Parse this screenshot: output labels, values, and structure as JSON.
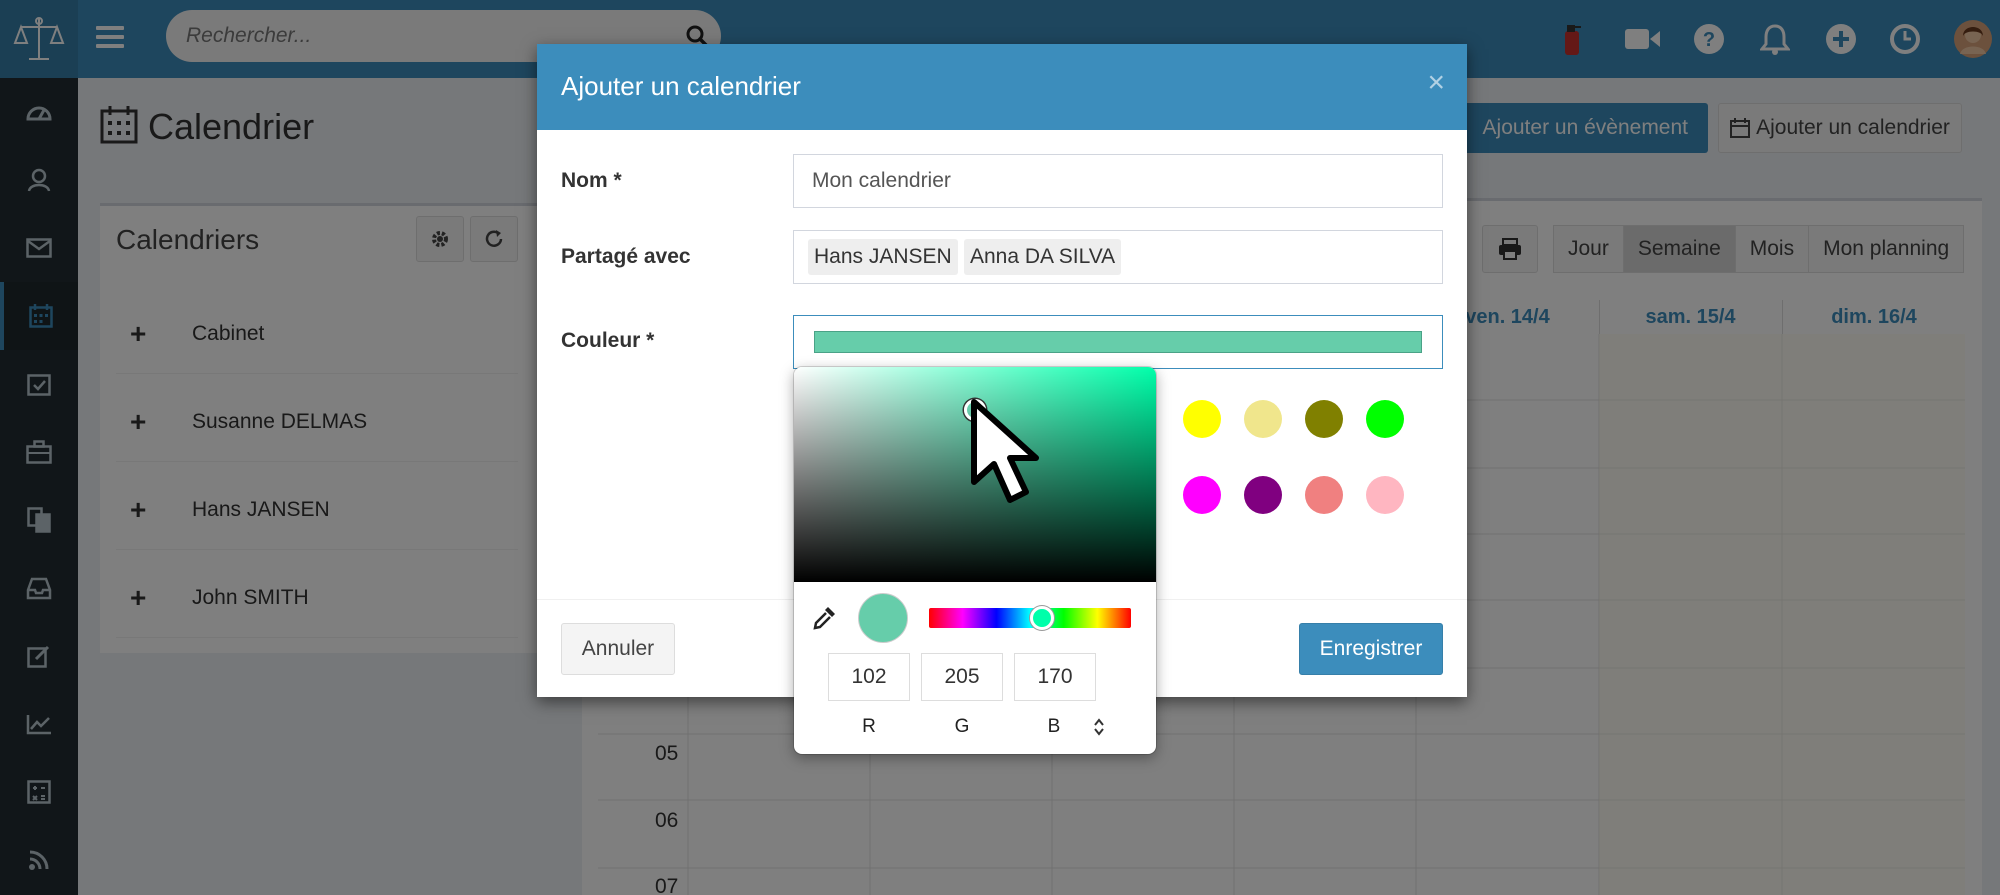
{
  "topbar": {
    "search_placeholder": "Rechercher...",
    "icons": [
      "scales-logo-icon",
      "menu-icon",
      "search-icon",
      "fire-extinguisher-icon",
      "video-icon",
      "help-icon",
      "bell-icon",
      "plus-circle-icon",
      "clock-icon",
      "user-avatar"
    ]
  },
  "sidebar": {
    "icons": [
      "dashboard-icon",
      "contacts-icon",
      "mail-icon",
      "calendar-icon",
      "tasks-icon",
      "briefcase-icon",
      "documents-icon",
      "inbox-icon",
      "edit-icon",
      "chart-icon",
      "calculator-icon",
      "rss-icon"
    ],
    "active": "calendar-icon"
  },
  "page": {
    "title": "Calendrier",
    "add_event_label": "Ajouter un évènement",
    "add_calendar_label": "Ajouter un calendrier"
  },
  "calendars_box": {
    "title": "Calendriers",
    "items": [
      {
        "label": "Cabinet"
      },
      {
        "label": "Susanne DELMAS"
      },
      {
        "label": "Hans JANSEN"
      },
      {
        "label": "John SMITH"
      }
    ]
  },
  "calendar_view": {
    "views": [
      "Jour",
      "Semaine",
      "Mois",
      "Mon planning"
    ],
    "selected_view": "Semaine",
    "day_headers": [
      "ven. 14/4",
      "sam. 15/4",
      "dim. 16/4"
    ],
    "hours": [
      "05",
      "06",
      "07"
    ]
  },
  "modal": {
    "title": "Ajouter un calendrier",
    "close": "×",
    "name_label": "Nom *",
    "name_value": "Mon calendrier",
    "shared_label": "Partagé avec",
    "shared_with": [
      "Hans JANSEN",
      "Anna DA SILVA"
    ],
    "color_label": "Couleur *",
    "selected_color": "#66cdaa",
    "swatches_row1": [
      "#a52a2a",
      "#ffff00",
      "#f0e68c",
      "#808000",
      "#00ff00"
    ],
    "swatches_row2": [
      "#00008b",
      "#ff00ff",
      "#800080",
      "#f08080",
      "#ffb6c1"
    ],
    "cancel_label": "Annuler",
    "save_label": "Enregistrer"
  },
  "color_picker": {
    "r": "102",
    "g": "205",
    "b": "170",
    "r_label": "R",
    "g_label": "G",
    "b_label": "B",
    "hue_color": "#00ffaa"
  }
}
